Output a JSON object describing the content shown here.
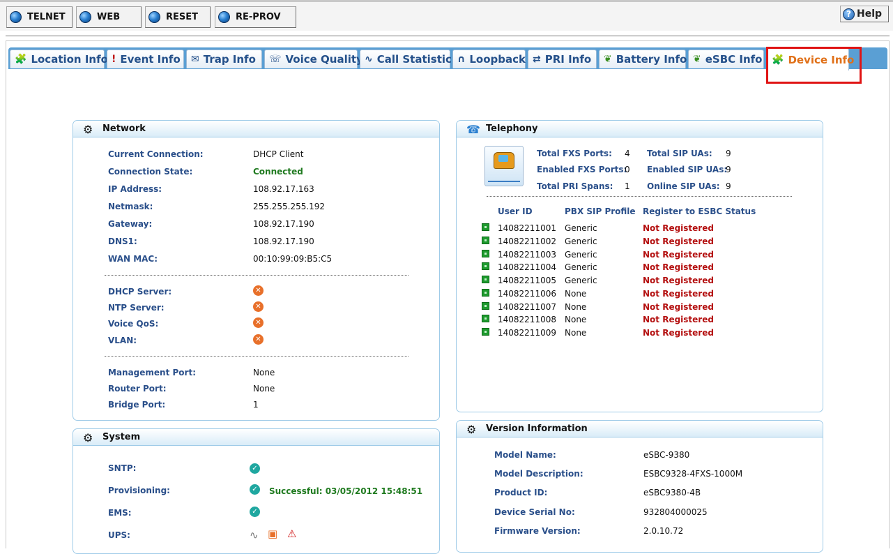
{
  "toolbar": {
    "buttons": [
      "TELNET",
      "WEB",
      "RESET",
      "RE-PROV"
    ],
    "help_label": "Help"
  },
  "tabs": [
    {
      "label": "Location Info",
      "icon": "location-icon"
    },
    {
      "label": "Event Info",
      "icon": "exclamation-icon"
    },
    {
      "label": "Trap Info",
      "icon": "trap-icon"
    },
    {
      "label": "Voice Quality",
      "icon": "voice-icon"
    },
    {
      "label": "Call Statistic",
      "icon": "chart-icon"
    },
    {
      "label": "Loopback",
      "icon": "loopback-icon"
    },
    {
      "label": "PRI Info",
      "icon": "pri-icon"
    },
    {
      "label": "Battery Info",
      "icon": "leaf-icon"
    },
    {
      "label": "eSBC Info",
      "icon": "leaf-icon"
    },
    {
      "label": "Device Info",
      "icon": "device-icon",
      "active": true
    }
  ],
  "network": {
    "title": "Network",
    "rows": [
      {
        "label": "Current Connection:",
        "value": "DHCP Client"
      },
      {
        "label": "Connection State:",
        "value": "Connected"
      },
      {
        "label": "IP Address:",
        "value": "108.92.17.163"
      },
      {
        "label": "Netmask:",
        "value": "255.255.255.192"
      },
      {
        "label": "Gateway:",
        "value": "108.92.17.190"
      },
      {
        "label": "DNS1:",
        "value": "108.92.17.190"
      },
      {
        "label": "WAN MAC:",
        "value": "00:10:99:09:B5:C5"
      }
    ],
    "services": [
      {
        "label": "DHCP Server:",
        "status": "disabled"
      },
      {
        "label": "NTP Server:",
        "status": "disabled"
      },
      {
        "label": "Voice QoS:",
        "status": "disabled"
      },
      {
        "label": "VLAN:",
        "status": "disabled"
      }
    ],
    "ports": [
      {
        "label": "Management Port:",
        "value": "None"
      },
      {
        "label": "Router Port:",
        "value": "None"
      },
      {
        "label": "Bridge Port:",
        "value": "1"
      }
    ]
  },
  "system": {
    "title": "System",
    "rows": [
      {
        "label": "SNTP:",
        "status": "ok",
        "note": ""
      },
      {
        "label": "Provisioning:",
        "status": "ok",
        "note": "Successful: 03/05/2012 15:48:51"
      },
      {
        "label": "EMS:",
        "status": "ok",
        "note": ""
      },
      {
        "label": "UPS:",
        "status": "icons",
        "note": ""
      }
    ]
  },
  "telephony": {
    "title": "Telephony",
    "stats": [
      {
        "label": "Total FXS Ports:",
        "value": "4"
      },
      {
        "label": "Enabled FXS Ports:",
        "value": "0"
      },
      {
        "label": "Total PRI Spans:",
        "value": "1"
      },
      {
        "label": "Total SIP UAs:",
        "value": "9"
      },
      {
        "label": "Enabled SIP UAs:",
        "value": "9"
      },
      {
        "label": "Online SIP UAs:",
        "value": "9"
      }
    ],
    "columns": [
      "User ID",
      "PBX SIP Profile",
      "Register to ESBC Status"
    ],
    "users": [
      {
        "id": "14082211001",
        "profile": "Generic",
        "status": "Not Registered"
      },
      {
        "id": "14082211002",
        "profile": "Generic",
        "status": "Not Registered"
      },
      {
        "id": "14082211003",
        "profile": "Generic",
        "status": "Not Registered"
      },
      {
        "id": "14082211004",
        "profile": "Generic",
        "status": "Not Registered"
      },
      {
        "id": "14082211005",
        "profile": "Generic",
        "status": "Not Registered"
      },
      {
        "id": "14082211006",
        "profile": "None",
        "status": "Not Registered"
      },
      {
        "id": "14082211007",
        "profile": "None",
        "status": "Not Registered"
      },
      {
        "id": "14082211008",
        "profile": "None",
        "status": "Not Registered"
      },
      {
        "id": "14082211009",
        "profile": "None",
        "status": "Not Registered"
      }
    ]
  },
  "version": {
    "title": "Version Information",
    "rows": [
      {
        "label": "Model Name:",
        "value": "eSBC-9380"
      },
      {
        "label": "Model Description:",
        "value": "ESBC9328-4FXS-1000M"
      },
      {
        "label": "Product ID:",
        "value": "eSBC9380-4B"
      },
      {
        "label": "Device Serial No:",
        "value": "932804000025"
      },
      {
        "label": "Firmware Version:",
        "value": "2.0.10.72"
      }
    ]
  },
  "colors": {
    "tab_bar": "#5a9fd4",
    "label_blue": "#2a4f8a",
    "ok_green": "#1f7a1f",
    "not_registered_red": "#b41010",
    "active_tab_orange": "#e07018",
    "highlight_red": "#e01414"
  }
}
